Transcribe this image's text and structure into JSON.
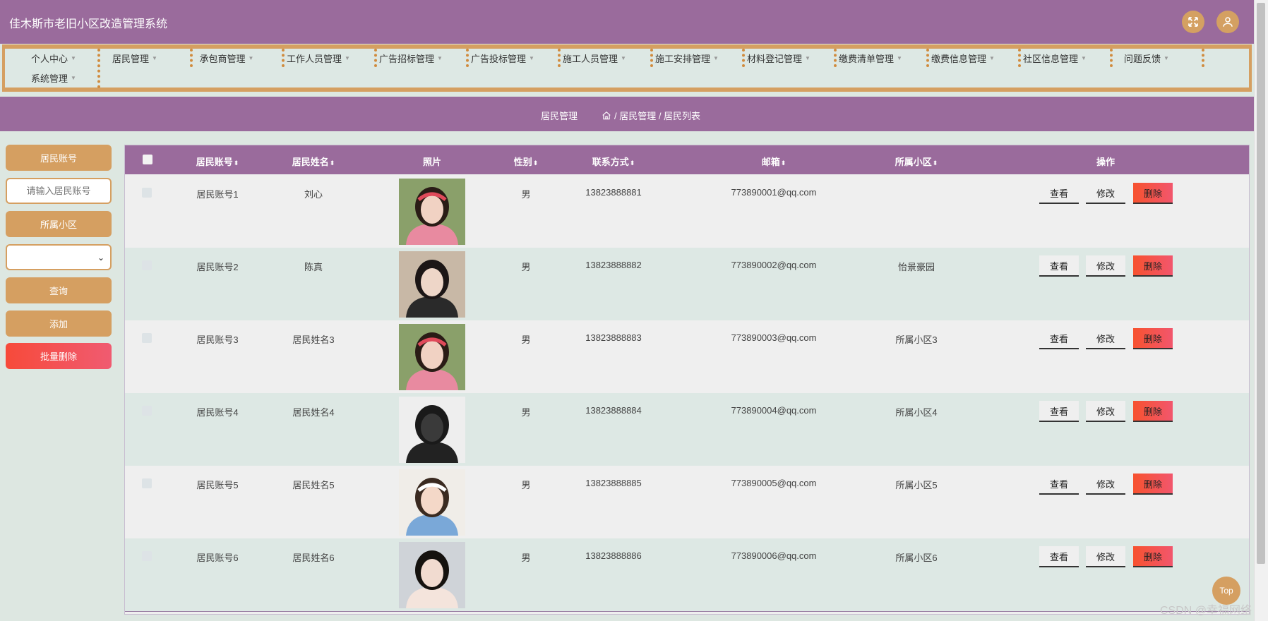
{
  "app": {
    "title": "佳木斯市老旧小区改造管理系统"
  },
  "topbar": {
    "fullscreen_icon": "fullscreen-icon",
    "user_icon": "user-icon"
  },
  "nav": {
    "items": [
      {
        "label": "个人中心"
      },
      {
        "label": "居民管理"
      },
      {
        "label": "承包商管理"
      },
      {
        "label": "工作人员管理"
      },
      {
        "label": "广告招标管理"
      },
      {
        "label": "广告投标管理"
      },
      {
        "label": "施工人员管理"
      },
      {
        "label": "施工安排管理"
      },
      {
        "label": "材料登记管理"
      },
      {
        "label": "缴费清单管理"
      },
      {
        "label": "缴费信息管理"
      },
      {
        "label": "社区信息管理"
      },
      {
        "label": "问题反馈"
      },
      {
        "label": "系统管理"
      }
    ]
  },
  "breadcrumb": {
    "section": "居民管理",
    "path": "/ 居民管理 / 居民列表"
  },
  "sidebar": {
    "account_label": "居民账号",
    "account_placeholder": "请输入居民账号",
    "community_label": "所属小区",
    "community_value": "",
    "query_button": "查询",
    "add_button": "添加",
    "batch_delete_button": "批量删除"
  },
  "table": {
    "headers": {
      "account": "居民账号",
      "name": "居民姓名",
      "photo": "照片",
      "gender": "性别",
      "phone": "联系方式",
      "email": "邮箱",
      "community": "所属小区",
      "actions": "操作"
    },
    "rows": [
      {
        "account": "居民账号1",
        "name": "刘心",
        "gender": "男",
        "phone": "13823888881",
        "email": "773890001@qq.com",
        "community": ""
      },
      {
        "account": "居民账号2",
        "name": "陈真",
        "gender": "男",
        "phone": "13823888882",
        "email": "773890002@qq.com",
        "community": "怡景豪园"
      },
      {
        "account": "居民账号3",
        "name": "居民姓名3",
        "gender": "男",
        "phone": "13823888883",
        "email": "773890003@qq.com",
        "community": "所属小区3"
      },
      {
        "account": "居民账号4",
        "name": "居民姓名4",
        "gender": "男",
        "phone": "13823888884",
        "email": "773890004@qq.com",
        "community": "所属小区4"
      },
      {
        "account": "居民账号5",
        "name": "居民姓名5",
        "gender": "男",
        "phone": "13823888885",
        "email": "773890005@qq.com",
        "community": "所属小区5"
      },
      {
        "account": "居民账号6",
        "name": "居民姓名6",
        "gender": "男",
        "phone": "13823888886",
        "email": "773890006@qq.com",
        "community": "所属小区6"
      }
    ],
    "actions": {
      "view": "查看",
      "edit": "修改",
      "delete": "删除"
    }
  },
  "back_to_top": "Top",
  "watermark": "CSDN @幸福网络",
  "colors": {
    "primary": "#9a6b9c",
    "accent": "#d59f61",
    "danger": "#f7522f",
    "background": "#dde7e1"
  }
}
